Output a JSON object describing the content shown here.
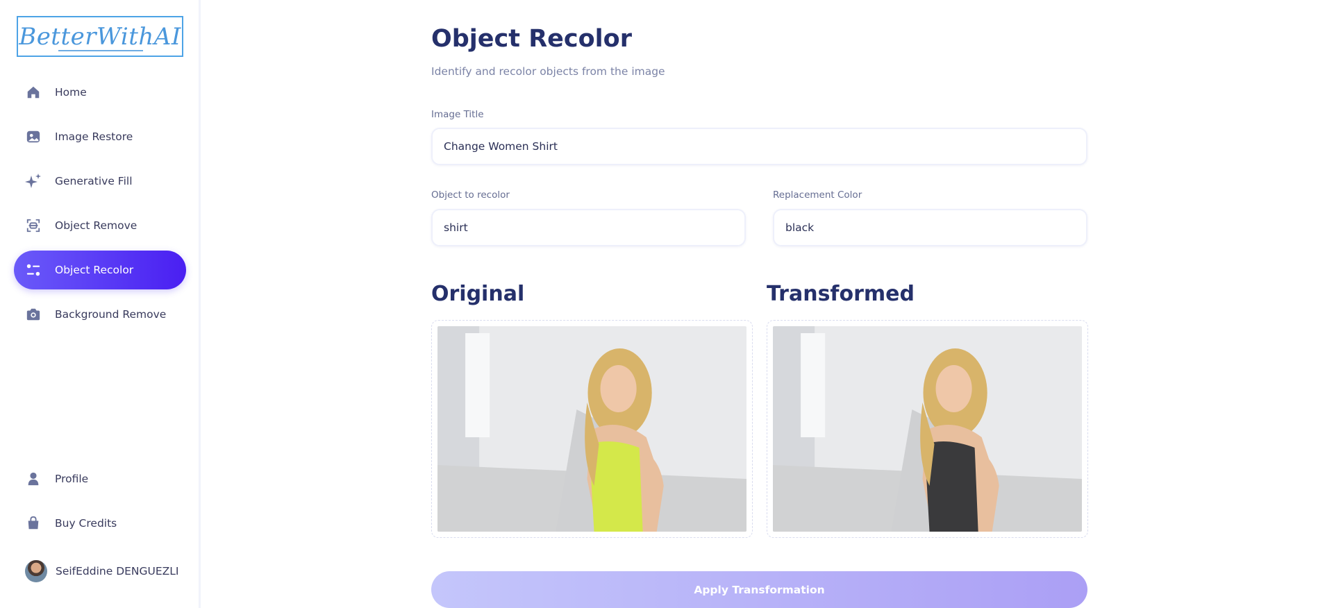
{
  "brand": {
    "logo_text": "BetterWithAI"
  },
  "sidebar": {
    "items": [
      {
        "label": "Home",
        "icon": "home-icon"
      },
      {
        "label": "Image Restore",
        "icon": "image-icon"
      },
      {
        "label": "Generative Fill",
        "icon": "sparkles-icon"
      },
      {
        "label": "Object Remove",
        "icon": "scan-icon"
      },
      {
        "label": "Object Recolor",
        "icon": "filter-icon",
        "active": true
      },
      {
        "label": "Background Remove",
        "icon": "camera-icon"
      }
    ],
    "bottom": [
      {
        "label": "Profile",
        "icon": "user-icon"
      },
      {
        "label": "Buy Credits",
        "icon": "bag-icon"
      }
    ],
    "user": {
      "name": "SeifEddine DENGUEZLI"
    }
  },
  "main": {
    "title": "Object Recolor",
    "subtitle": "Identify and recolor objects from the image",
    "image_title": {
      "label": "Image Title",
      "value": "Change Women Shirt"
    },
    "object": {
      "label": "Object to recolor",
      "value": "shirt"
    },
    "color": {
      "label": "Replacement Color",
      "value": "black"
    },
    "original_title": "Original",
    "transformed_title": "Transformed",
    "apply_label": "Apply Transformation"
  },
  "colors": {
    "accent": "#5b3cf5",
    "heading": "#25306b",
    "shirt_original": "#d4e84a",
    "shirt_transformed": "#3a3a3c"
  }
}
